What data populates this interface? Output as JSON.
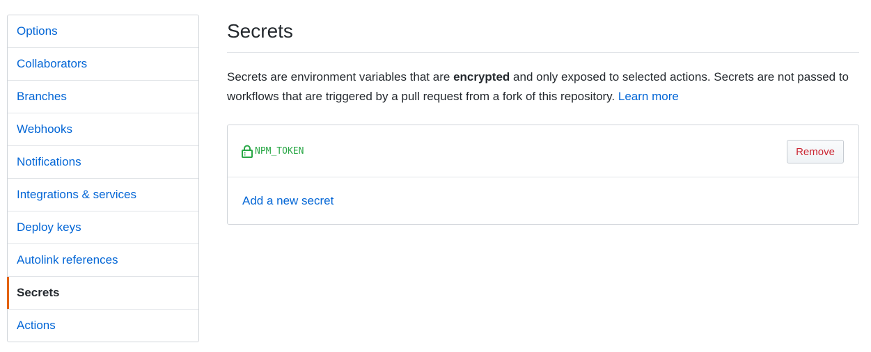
{
  "sidebar": {
    "items": [
      {
        "label": "Options",
        "selected": false
      },
      {
        "label": "Collaborators",
        "selected": false
      },
      {
        "label": "Branches",
        "selected": false
      },
      {
        "label": "Webhooks",
        "selected": false
      },
      {
        "label": "Notifications",
        "selected": false
      },
      {
        "label": "Integrations & services",
        "selected": false
      },
      {
        "label": "Deploy keys",
        "selected": false
      },
      {
        "label": "Autolink references",
        "selected": false
      },
      {
        "label": "Secrets",
        "selected": true
      },
      {
        "label": "Actions",
        "selected": false
      }
    ]
  },
  "main": {
    "title": "Secrets",
    "description": {
      "part1": "Secrets are environment variables that are ",
      "emphasis": "encrypted",
      "part2": " and only exposed to selected actions. Secrets are not passed to workflows that are triggered by a pull request from a fork of this repository. ",
      "learn_more": "Learn more"
    },
    "secrets": [
      {
        "name": "NPM_TOKEN",
        "icon": "lock-icon",
        "remove_label": "Remove"
      }
    ],
    "add_secret_label": "Add a new secret"
  },
  "colors": {
    "link": "#0366d6",
    "selected_indicator": "#e36209",
    "secret_name": "#28a745",
    "danger": "#cb2431"
  }
}
